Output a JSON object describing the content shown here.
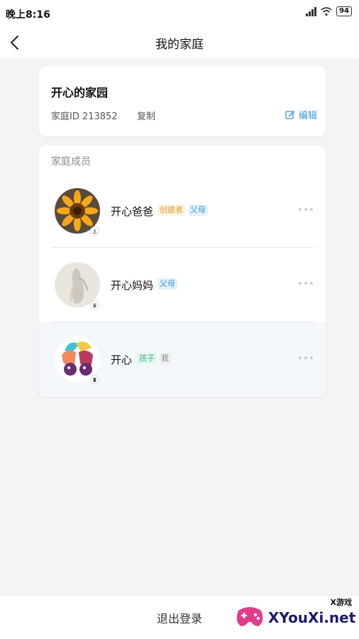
{
  "status_bar": {
    "time": "晚上8:16",
    "battery": "94"
  },
  "nav": {
    "title": "我的家庭"
  },
  "family": {
    "name": "开心的家园",
    "id_text": "家庭ID 213852",
    "copy_label": "复制",
    "edit_label": "编辑"
  },
  "members_section": {
    "title": "家庭成员",
    "members": [
      {
        "name": "开心爸爸",
        "tags": [
          "创建者",
          "父母"
        ],
        "avatar": "sunflower-photo"
      },
      {
        "name": "开心妈妈",
        "tags": [
          "父母"
        ],
        "avatar": "figure-photo"
      },
      {
        "name": "开心",
        "tags": [
          "孩子",
          "我"
        ],
        "avatar": "cartoon-illustration"
      }
    ]
  },
  "bottom": {
    "logout_label": "退出登录"
  },
  "watermark": {
    "text": "XYouXi.net",
    "small_text": "X游戏"
  },
  "colors": {
    "accent": "#3a96d8",
    "creator_tag": "#e0a13a",
    "child_tag": "#3bb48a"
  }
}
